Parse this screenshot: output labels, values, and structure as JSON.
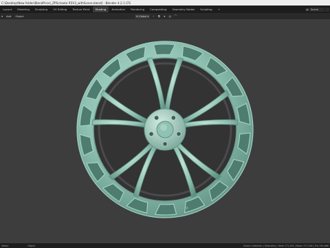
{
  "window": {
    "title": "C:\\Desktop\\New folder\\BlendPrice\\_ZPSchaeta R5V3_withScene.blend] - Blender 4.2.1 LTS"
  },
  "topbar": {
    "tabs": [
      {
        "label": "Layout"
      },
      {
        "label": "Modeling"
      },
      {
        "label": "Sculpting"
      },
      {
        "label": "UV Editing"
      },
      {
        "label": "Texture Paint"
      },
      {
        "label": "Shading"
      },
      {
        "label": "Animation"
      },
      {
        "label": "Rendering"
      },
      {
        "label": "Compositing"
      },
      {
        "label": "Geometry Nodes"
      },
      {
        "label": "Scripting"
      }
    ],
    "active_tab": "Shading",
    "add_workspace": "+",
    "scene_name": "Scene",
    "scene_extra": ""
  },
  "header": {
    "left_items": [
      {
        "label": "Add"
      },
      {
        "label": "Object"
      }
    ],
    "transform_orientation": "Global"
  },
  "statusbar": {
    "select_label": "Select",
    "object_label": "Object",
    "stats": "Scene Collection | Geometry | Verts 171,193 | Faces 177,348 | Tris 354,696"
  },
  "colors": {
    "wheel": "#8fc2b2",
    "wheel_dark": "#5e8f80",
    "wheel_light": "#bfe2d6",
    "viewport_bg": "#3d3d3d"
  }
}
